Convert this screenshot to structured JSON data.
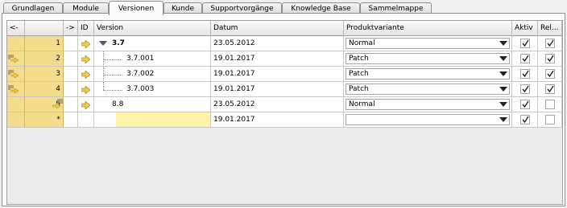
{
  "tabs": [
    {
      "label": "Grundlagen",
      "active": false
    },
    {
      "label": "Module",
      "active": false
    },
    {
      "label": "Versionen",
      "active": true
    },
    {
      "label": "Kunde",
      "active": false
    },
    {
      "label": "Supportvorgänge",
      "active": false
    },
    {
      "label": "Knowledge Base",
      "active": false
    },
    {
      "label": "Sammelmappe",
      "active": false
    }
  ],
  "columns": {
    "prev": "<-",
    "next": "->",
    "id": "ID",
    "version": "Version",
    "datum": "Datum",
    "produktvariante": "Produktvariante",
    "aktiv": "Aktiv",
    "rel": "Rel..."
  },
  "rows": [
    {
      "num": "1",
      "version": "3.7",
      "datum": "23.05.2012",
      "variante": "Normal",
      "aktiv": true,
      "rel": true
    },
    {
      "num": "2",
      "version": "3.7.001",
      "datum": "19.01.2017",
      "variante": "Patch",
      "aktiv": true,
      "rel": true
    },
    {
      "num": "3",
      "version": "3.7.002",
      "datum": "19.01.2017",
      "variante": "Patch",
      "aktiv": true,
      "rel": true
    },
    {
      "num": "4",
      "version": "3.7.003",
      "datum": "19.01.2017",
      "variante": "Patch",
      "aktiv": true,
      "rel": true
    },
    {
      "num": "5",
      "version": "8.8",
      "datum": "23.05.2012",
      "variante": "Normal",
      "aktiv": true,
      "rel": false
    },
    {
      "num": "*",
      "version": "",
      "datum": "19.01.2017",
      "variante": "",
      "aktiv": true,
      "rel": false
    }
  ],
  "icons": {
    "link_arrow": "arrow-right-icon",
    "tree_collapse": "triangle-down-icon",
    "row_child": "child-link-icon",
    "row_parent": "parent-link-icon",
    "checkmark": "check-icon",
    "dropdown": "chevron-down-icon"
  },
  "colors": {
    "row_header": "#f4dc8a",
    "selection": "#fff1a8",
    "arrow": "#f2c94c"
  }
}
